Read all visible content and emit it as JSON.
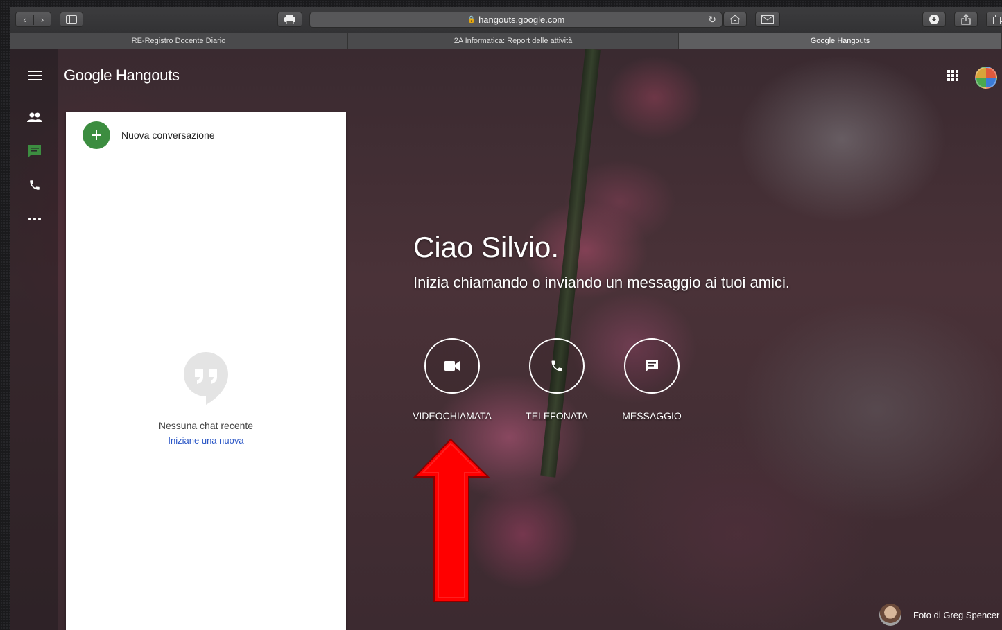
{
  "browser": {
    "url": "hangouts.google.com",
    "tabs": [
      {
        "label": "RE-Registro Docente Diario",
        "active": false
      },
      {
        "label": "2A Informatica: Report delle attività",
        "active": false
      },
      {
        "label": "Google Hangouts",
        "active": true
      }
    ]
  },
  "app": {
    "logo_google": "Google",
    "logo_product": "Hangouts"
  },
  "conversations": {
    "new_label": "Nuova conversazione",
    "empty_title": "Nessuna chat recente",
    "empty_link": "Iniziane una nuova"
  },
  "welcome": {
    "greeting": "Ciao Silvio.",
    "subtitle": "Inizia chiamando o inviando un messaggio ai tuoi amici.",
    "actions": [
      {
        "label": "VIDEOCHIAMATA",
        "icon": "videocam-icon"
      },
      {
        "label": "TELEFONATA",
        "icon": "phone-icon"
      },
      {
        "label": "MESSAGGIO",
        "icon": "message-icon"
      }
    ]
  },
  "photo_credit": "Foto di Greg Spencer",
  "colors": {
    "accent_green": "#3c8d40",
    "link_blue": "#2a56c6",
    "arrow_red": "#ff0000",
    "active_nav_icon": "#3c8d40"
  }
}
